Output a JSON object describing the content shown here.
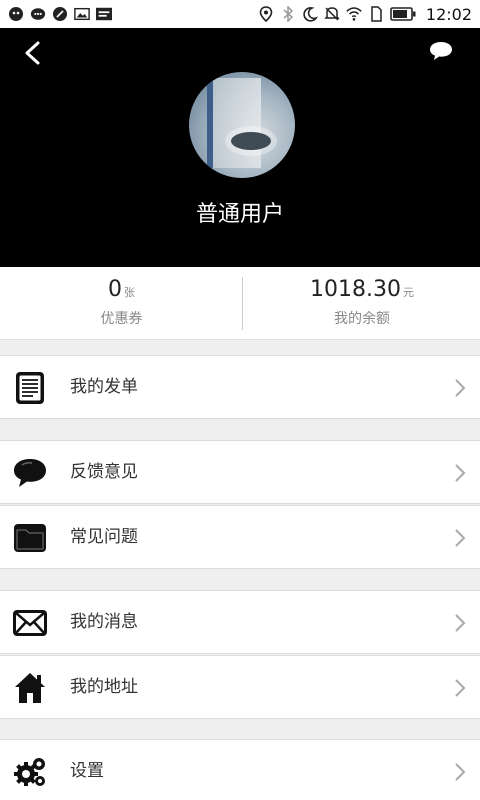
{
  "status_bar": {
    "time": "12:02",
    "left_icons": [
      "qq-icon",
      "wechat-icon",
      "message-icon",
      "image-icon",
      "news-app-icon"
    ],
    "right_icons": [
      "location-icon",
      "bluetooth-icon",
      "moon-icon",
      "mute-icon",
      "wifi-icon",
      "sim-icon",
      "battery-icon"
    ]
  },
  "header": {
    "username": "普通用户"
  },
  "stats": {
    "coupons_value": "0",
    "coupons_unit": "张",
    "coupons_label": "优惠券",
    "balance_value": "1018.30",
    "balance_unit": "元",
    "balance_label": "我的余额"
  },
  "menu": [
    {
      "label": "我的发单",
      "icon": "document-icon"
    },
    {
      "label": "反馈意见",
      "icon": "chat-bubble-icon"
    },
    {
      "label": "常见问题",
      "icon": "folder-icon"
    },
    {
      "label": "我的消息",
      "icon": "envelope-icon"
    },
    {
      "label": "我的地址",
      "icon": "home-icon"
    },
    {
      "label": "设置",
      "icon": "gears-icon"
    }
  ]
}
